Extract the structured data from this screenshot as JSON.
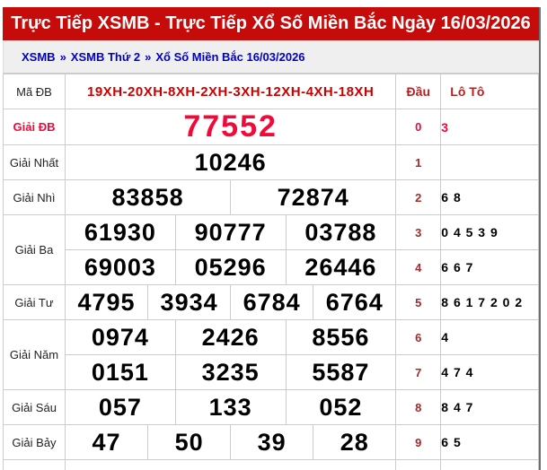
{
  "header": {
    "title": "Trực Tiếp XSMB - Trực Tiếp Xổ Số Miền Bắc Ngày 16/03/2026"
  },
  "breadcrumb": {
    "separator": "»",
    "items": [
      {
        "label": "XSMB"
      },
      {
        "label": "XSMB Thứ 2"
      },
      {
        "label": "Xổ Số Miền Bắc 16/03/2026"
      }
    ]
  },
  "table": {
    "head": {
      "label": "Mã ĐB",
      "code": "19XH-20XH-8XH-2XH-3XH-12XH-4XH-18XH",
      "dau": "Đầu",
      "loto": "Lô Tô"
    },
    "special": {
      "label": "Giải ĐB",
      "number": "77552",
      "dau": "0",
      "loto": "3"
    },
    "rows": [
      {
        "label": "Giải Nhất",
        "numbers": [
          "10246"
        ],
        "dau": "1",
        "loto": ""
      },
      {
        "label": "Giải Nhì",
        "numbers": [
          "83858",
          "72874"
        ],
        "dau": "2",
        "loto": "6 8"
      },
      {
        "label": "Giải Ba",
        "numbers": [
          "61930",
          "90777",
          "03788"
        ],
        "dau": "3",
        "loto": "0 4 5 3 9"
      },
      {
        "label": "",
        "numbers": [
          "69003",
          "05296",
          "26446"
        ],
        "dau": "4",
        "loto": "6 6 7"
      },
      {
        "label": "Giải Tư",
        "numbers": [
          "4795",
          "3934",
          "6784",
          "6764"
        ],
        "dau": "5",
        "loto": "8 6 1 7 2 0 2"
      },
      {
        "label": "Giải Năm",
        "numbers": [
          "0974",
          "2426",
          "8556"
        ],
        "dau": "6",
        "loto": "4"
      },
      {
        "label": "",
        "numbers": [
          "0151",
          "3235",
          "5587"
        ],
        "dau": "7",
        "loto": "4 7 4"
      },
      {
        "label": "Giải Sáu",
        "numbers": [
          "057",
          "133",
          "052"
        ],
        "dau": "8",
        "loto": "8 4 7"
      },
      {
        "label": "Giải Bảy",
        "numbers": [
          "47",
          "50",
          "39",
          "28"
        ],
        "dau": "9",
        "loto": "6 5"
      }
    ],
    "colors": {
      "header_bar": "#c60b0b",
      "special_red": "#f40838",
      "code_red": "#cc0000",
      "dau_maroon": "#a52a2a",
      "breadcrumb_blue": "#0000cc"
    }
  }
}
